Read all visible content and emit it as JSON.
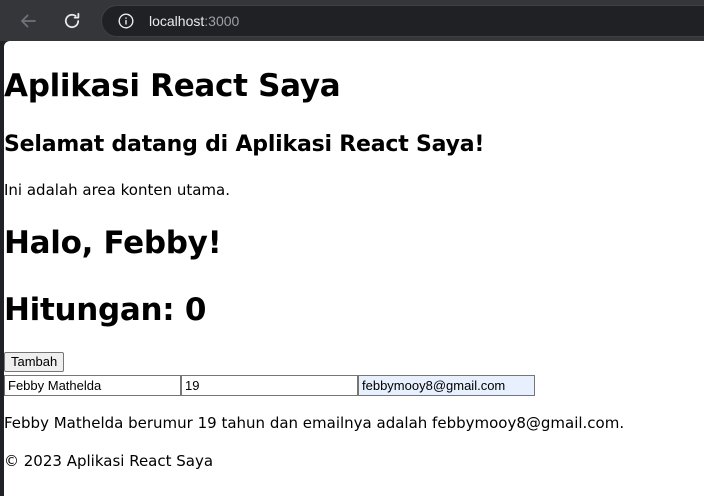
{
  "browser": {
    "url_host": "localhost",
    "url_port": ":3000"
  },
  "page": {
    "title": "Aplikasi React Saya",
    "welcome": "Selamat datang di Aplikasi React Saya!",
    "content_text": "Ini adalah area konten utama.",
    "greeting": "Halo, Febby!",
    "counter": "Hitungan: 0",
    "add_button_label": "Tambah",
    "form": {
      "name_value": "Febby Mathelda",
      "age_value": "19",
      "email_value": "febbymooy8@gmail.com"
    },
    "summary": "Febby Mathelda berumur 19 tahun dan emailnya adalah febbymooy8@gmail.com.",
    "footer": "© 2023 Aplikasi React Saya"
  },
  "colors": {
    "chrome_bg": "#35363a",
    "address_bg": "#202124",
    "autofill_bg": "#e8f0fe"
  },
  "icons": {
    "back": "arrow-left-icon",
    "reload": "reload-icon",
    "info": "info-icon"
  }
}
